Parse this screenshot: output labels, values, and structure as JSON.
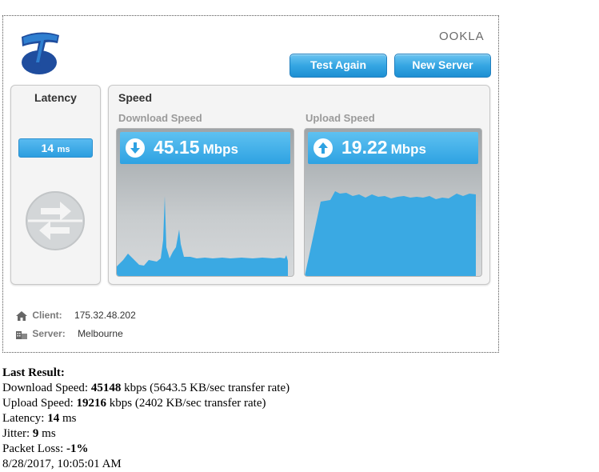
{
  "header": {
    "brand_logo": "telstra-logo",
    "provider_logo_text": "OOKLA",
    "buttons": {
      "test_again": "Test Again",
      "new_server": "New Server"
    }
  },
  "latency_panel": {
    "title": "Latency",
    "value": "14",
    "unit": "ms",
    "icon": "arrows-icon"
  },
  "speed_panel": {
    "title": "Speed",
    "download": {
      "label": "Download Speed",
      "value": "45.15",
      "unit": "Mbps",
      "icon": "arrow-down-circle-icon"
    },
    "upload": {
      "label": "Upload Speed",
      "value": "19.22",
      "unit": "Mbps",
      "icon": "arrow-up-circle-icon"
    }
  },
  "info": {
    "client_label": "Client:",
    "client_value": "175.32.48.202",
    "server_label": "Server:",
    "server_value": "Melbourne"
  },
  "last_result": {
    "heading": "Last Result:",
    "download_label": "Download Speed: ",
    "download_value": "45148",
    "download_rest": " kbps (5643.5 KB/sec transfer rate)",
    "upload_label": "Upload Speed: ",
    "upload_value": "19216",
    "upload_rest": " kbps (2402 KB/sec transfer rate)",
    "latency_label": "Latency: ",
    "latency_value": "14",
    "latency_rest": " ms",
    "jitter_label": "Jitter: ",
    "jitter_value": "9",
    "jitter_rest": " ms",
    "packet_loss_label": "Packet Loss: ",
    "packet_loss_value": "-1%",
    "timestamp": "8/28/2017, 10:05:01 AM"
  },
  "colors": {
    "accent": "#35a6e3",
    "graph_fill": "#3aa9e3",
    "panel_bg": "#f4f4f4"
  }
}
